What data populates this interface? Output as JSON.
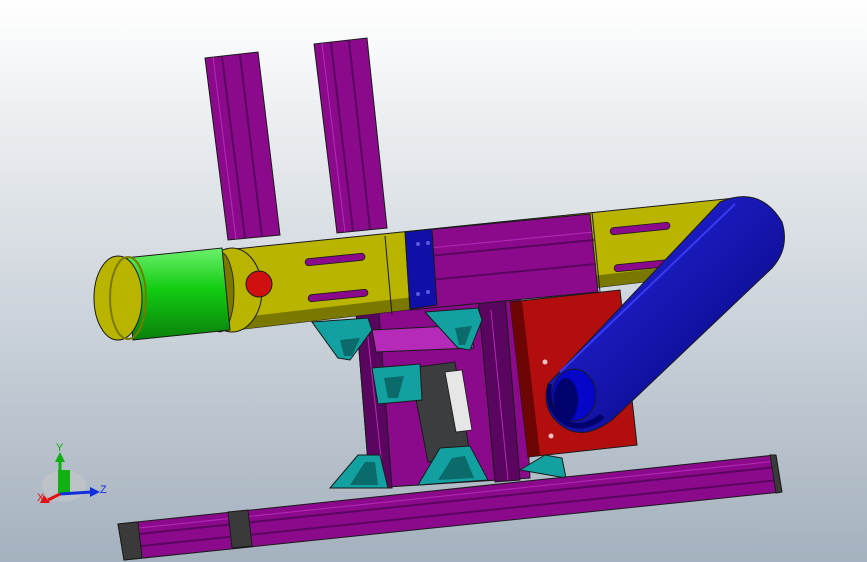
{
  "viewport": {
    "background_top": "#ffffff",
    "background_bottom": "#a4b1be"
  },
  "colors": {
    "frame_purple": "#8b0a8c",
    "frame_purple_dark": "#5a0660",
    "frame_purple_light": "#b52ab8",
    "belt_yellow": "#b8b400",
    "belt_yellow_dark": "#7b7800",
    "roller_green": "#12cc12",
    "roller_green_dark": "#0a7f0a",
    "bracket_teal": "#13a0a0",
    "bracket_teal_dark": "#0b6a6a",
    "plate_red": "#b30e0e",
    "plate_red_dark": "#6e0505",
    "belt_blue": "#0606c8",
    "belt_blue_dark": "#02026e",
    "hole_red": "#d01010",
    "edge_dark": "#1a1a1a",
    "end_cap_gray": "#3a3a3a"
  },
  "triad": {
    "x_label": "X",
    "y_label": "Y",
    "z_label": "Z",
    "x_color": "#e01010",
    "y_color": "#10b010",
    "z_color": "#1030e0"
  }
}
